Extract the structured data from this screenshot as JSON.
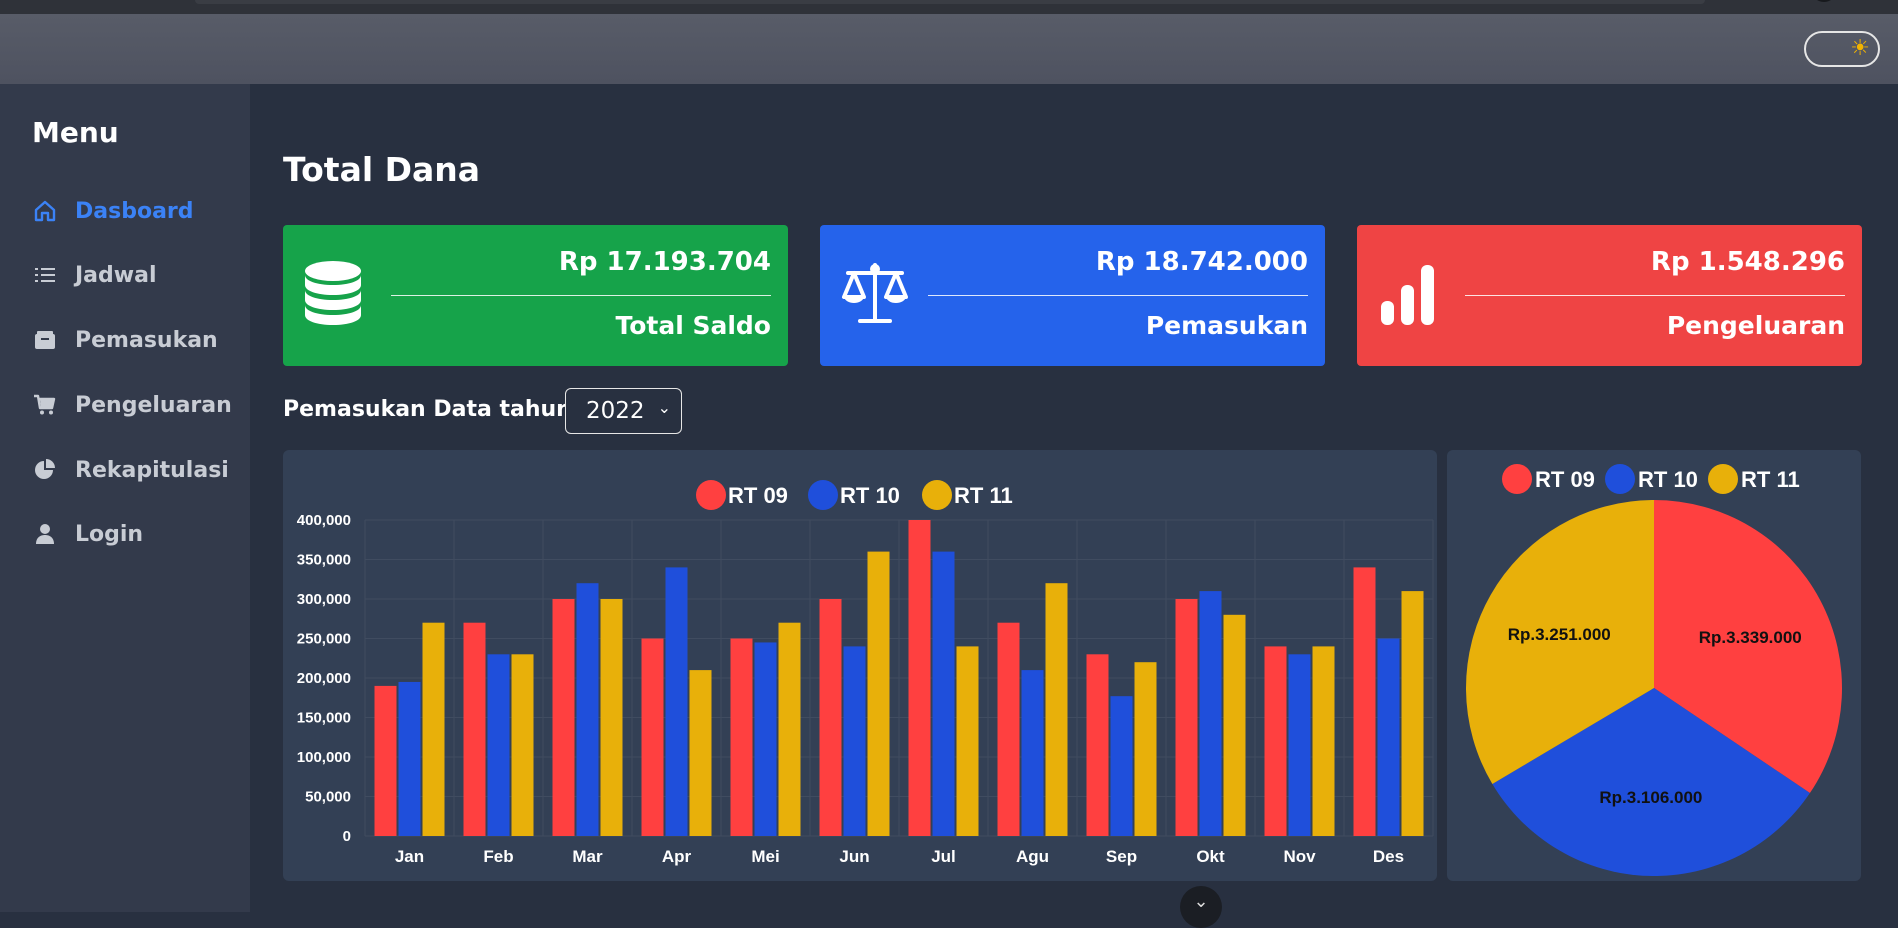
{
  "sidebar": {
    "title": "Menu",
    "items": [
      {
        "label": "Dasboard",
        "icon": "home-icon",
        "active": true
      },
      {
        "label": "Jadwal",
        "icon": "list-icon"
      },
      {
        "label": "Pemasukan",
        "icon": "wallet-icon"
      },
      {
        "label": "Pengeluaran",
        "icon": "cart-icon"
      },
      {
        "label": "Rekapitulasi",
        "icon": "pie-chart-icon"
      },
      {
        "label": "Login",
        "icon": "user-icon"
      }
    ]
  },
  "header": {
    "theme_toggle_icon": "sun-icon"
  },
  "main": {
    "title": "Total Dana",
    "cards": [
      {
        "amount": "Rp 17.193.704",
        "label": "Total Saldo",
        "color": "#16a34a",
        "icon": "coins-stack-icon"
      },
      {
        "amount": "Rp 18.742.000",
        "label": "Pemasukan",
        "color": "#2563eb",
        "icon": "scale-balance-icon"
      },
      {
        "amount": "Rp 1.548.296",
        "label": "Pengeluaran",
        "color": "#ef4444",
        "icon": "bar-chart-icon"
      }
    ],
    "filter": {
      "label": "Pemasukan Data tahun :",
      "year": "2022"
    }
  },
  "chart_data": [
    {
      "type": "bar",
      "categories": [
        "Jan",
        "Feb",
        "Mar",
        "Apr",
        "Mei",
        "Jun",
        "Jul",
        "Agu",
        "Sep",
        "Okt",
        "Nov",
        "Des"
      ],
      "series": [
        {
          "name": "RT 09",
          "color": "#ff4040",
          "values": [
            190000,
            270000,
            300000,
            250000,
            250000,
            300000,
            400000,
            270000,
            230000,
            300000,
            240000,
            340000
          ]
        },
        {
          "name": "RT 10",
          "color": "#1f4fdb",
          "values": [
            195000,
            230000,
            320000,
            340000,
            245000,
            240000,
            360000,
            210000,
            177000,
            310000,
            230000,
            250000
          ]
        },
        {
          "name": "RT 11",
          "color": "#e8b00a",
          "values": [
            270000,
            230000,
            300000,
            210000,
            270000,
            360000,
            240000,
            320000,
            220000,
            280000,
            240000,
            310000
          ]
        }
      ],
      "yticks": [
        "0",
        "50,000",
        "100,000",
        "150,000",
        "200,000",
        "250,000",
        "300,000",
        "350,000",
        "400,000"
      ],
      "ylim": [
        0,
        400000
      ],
      "grid": true,
      "legend": "top-center"
    },
    {
      "type": "pie",
      "labels": [
        "RT 09",
        "RT 10",
        "RT 11"
      ],
      "values": [
        3339000,
        3106000,
        3251000
      ],
      "data_labels": [
        "Rp.3.339.000",
        "Rp.3.106.000",
        "Rp.3.251.000"
      ],
      "colors": [
        "#ff4040",
        "#1f4fdb",
        "#e8b00a"
      ],
      "legend": "top-center"
    }
  ]
}
